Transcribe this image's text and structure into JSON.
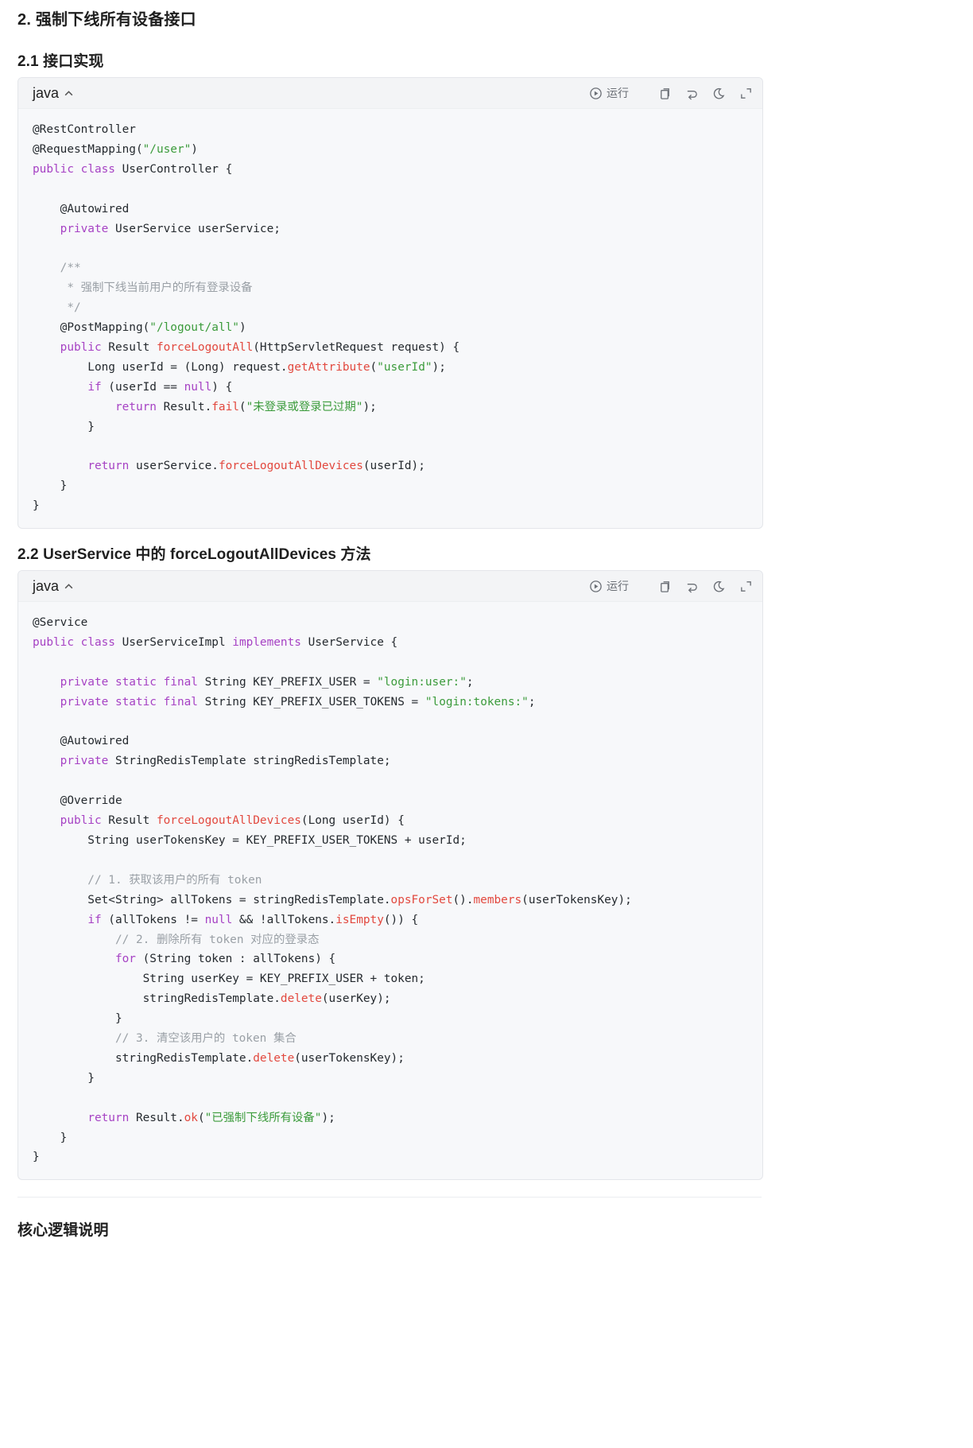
{
  "section_title": "2. 强制下线所有设备接口",
  "subsection1_title": "2.1 接口实现",
  "subsection2_title": "2.2 UserService 中的 forceLogoutAllDevices 方法",
  "footer_heading": "核心逻辑说明",
  "code_toolbar": {
    "language": "java",
    "run_label": "运行",
    "icons": [
      "play-circle-icon",
      "copy-icon",
      "wrap-icon",
      "theme-moon-icon",
      "expand-icon"
    ]
  },
  "colors": {
    "keyword": "#a642c4",
    "string": "#3b9b3b",
    "method": "#e2483e",
    "comment": "#9aa0a6"
  },
  "code_block_1_lines": [
    [
      [
        "@RestController",
        ""
      ]
    ],
    [
      [
        "@RequestMapping(",
        ""
      ],
      [
        "\"/user\"",
        "str"
      ],
      [
        ")",
        ""
      ]
    ],
    [
      [
        "public",
        "kw"
      ],
      [
        " ",
        ""
      ],
      [
        "class",
        "kw"
      ],
      [
        " UserController {",
        ""
      ]
    ],
    [],
    [
      [
        "    @Autowired",
        ""
      ]
    ],
    [
      [
        "    ",
        ""
      ],
      [
        "private",
        "kw"
      ],
      [
        " UserService userService;",
        ""
      ]
    ],
    [],
    [
      [
        "    /**",
        "cm"
      ]
    ],
    [
      [
        "     * 强制下线当前用户的所有登录设备",
        "cm"
      ]
    ],
    [
      [
        "     */",
        "cm"
      ]
    ],
    [
      [
        "    @PostMapping(",
        ""
      ],
      [
        "\"/logout/all\"",
        "str"
      ],
      [
        ")",
        ""
      ]
    ],
    [
      [
        "    ",
        ""
      ],
      [
        "public",
        "kw"
      ],
      [
        " Result ",
        ""
      ],
      [
        "forceLogoutAll",
        "fn"
      ],
      [
        "(HttpServletRequest request) {",
        ""
      ]
    ],
    [
      [
        "        Long userId = (Long) request.",
        ""
      ],
      [
        "getAttribute",
        "fn"
      ],
      [
        "(",
        ""
      ],
      [
        "\"userId\"",
        "str"
      ],
      [
        ");",
        ""
      ]
    ],
    [
      [
        "        ",
        ""
      ],
      [
        "if",
        "kw"
      ],
      [
        " (userId == ",
        ""
      ],
      [
        "null",
        "lit"
      ],
      [
        ") {",
        ""
      ]
    ],
    [
      [
        "            ",
        ""
      ],
      [
        "return",
        "kw"
      ],
      [
        " Result.",
        ""
      ],
      [
        "fail",
        "fn"
      ],
      [
        "(",
        ""
      ],
      [
        "\"未登录或登录已过期\"",
        "str"
      ],
      [
        ");",
        ""
      ]
    ],
    [
      [
        "        }",
        ""
      ]
    ],
    [],
    [
      [
        "        ",
        ""
      ],
      [
        "return",
        "kw"
      ],
      [
        " userService.",
        ""
      ],
      [
        "forceLogoutAllDevices",
        "fn"
      ],
      [
        "(userId);",
        ""
      ]
    ],
    [
      [
        "    }",
        ""
      ]
    ],
    [
      [
        "}",
        ""
      ]
    ]
  ],
  "code_block_2_lines": [
    [
      [
        "@Service",
        ""
      ]
    ],
    [
      [
        "public",
        "kw"
      ],
      [
        " ",
        ""
      ],
      [
        "class",
        "kw"
      ],
      [
        " UserServiceImpl ",
        ""
      ],
      [
        "implements",
        "kw"
      ],
      [
        " UserService {",
        ""
      ]
    ],
    [],
    [
      [
        "    ",
        ""
      ],
      [
        "private",
        "kw"
      ],
      [
        " ",
        ""
      ],
      [
        "static",
        "kw"
      ],
      [
        " ",
        ""
      ],
      [
        "final",
        "kw"
      ],
      [
        " String KEY_PREFIX_USER = ",
        ""
      ],
      [
        "\"login:user:\"",
        "str"
      ],
      [
        ";",
        ""
      ]
    ],
    [
      [
        "    ",
        ""
      ],
      [
        "private",
        "kw"
      ],
      [
        " ",
        ""
      ],
      [
        "static",
        "kw"
      ],
      [
        " ",
        ""
      ],
      [
        "final",
        "kw"
      ],
      [
        " String KEY_PREFIX_USER_TOKENS = ",
        ""
      ],
      [
        "\"login:tokens:\"",
        "str"
      ],
      [
        ";",
        ""
      ]
    ],
    [],
    [
      [
        "    @Autowired",
        ""
      ]
    ],
    [
      [
        "    ",
        ""
      ],
      [
        "private",
        "kw"
      ],
      [
        " StringRedisTemplate stringRedisTemplate;",
        ""
      ]
    ],
    [],
    [
      [
        "    @Override",
        ""
      ]
    ],
    [
      [
        "    ",
        ""
      ],
      [
        "public",
        "kw"
      ],
      [
        " Result ",
        ""
      ],
      [
        "forceLogoutAllDevices",
        "fn"
      ],
      [
        "(Long userId) {",
        ""
      ]
    ],
    [
      [
        "        String userTokensKey = KEY_PREFIX_USER_TOKENS + userId;",
        ""
      ]
    ],
    [],
    [
      [
        "        // 1. 获取该用户的所有 token",
        "cm"
      ]
    ],
    [
      [
        "        Set<String> allTokens = stringRedisTemplate.",
        ""
      ],
      [
        "opsForSet",
        "fn"
      ],
      [
        "().",
        ""
      ],
      [
        "members",
        "fn"
      ],
      [
        "(userTokensKey);",
        ""
      ]
    ],
    [
      [
        "        ",
        ""
      ],
      [
        "if",
        "kw"
      ],
      [
        " (allTokens != ",
        ""
      ],
      [
        "null",
        "lit"
      ],
      [
        " && !allTokens.",
        ""
      ],
      [
        "isEmpty",
        "fn"
      ],
      [
        "()) {",
        ""
      ]
    ],
    [
      [
        "            // 2. 删除所有 token 对应的登录态",
        "cm"
      ]
    ],
    [
      [
        "            ",
        ""
      ],
      [
        "for",
        "kw"
      ],
      [
        " (String token : allTokens) {",
        ""
      ]
    ],
    [
      [
        "                String userKey = KEY_PREFIX_USER + token;",
        ""
      ]
    ],
    [
      [
        "                stringRedisTemplate.",
        ""
      ],
      [
        "delete",
        "fn"
      ],
      [
        "(userKey);",
        ""
      ]
    ],
    [
      [
        "            }",
        ""
      ]
    ],
    [
      [
        "            // 3. 清空该用户的 token 集合",
        "cm"
      ]
    ],
    [
      [
        "            stringRedisTemplate.",
        ""
      ],
      [
        "delete",
        "fn"
      ],
      [
        "(userTokensKey);",
        ""
      ]
    ],
    [
      [
        "        }",
        ""
      ]
    ],
    [],
    [
      [
        "        ",
        ""
      ],
      [
        "return",
        "kw"
      ],
      [
        " Result.",
        ""
      ],
      [
        "ok",
        "fn"
      ],
      [
        "(",
        ""
      ],
      [
        "\"已强制下线所有设备\"",
        "str"
      ],
      [
        ");",
        ""
      ]
    ],
    [
      [
        "    }",
        ""
      ]
    ],
    [
      [
        "}",
        ""
      ]
    ]
  ]
}
